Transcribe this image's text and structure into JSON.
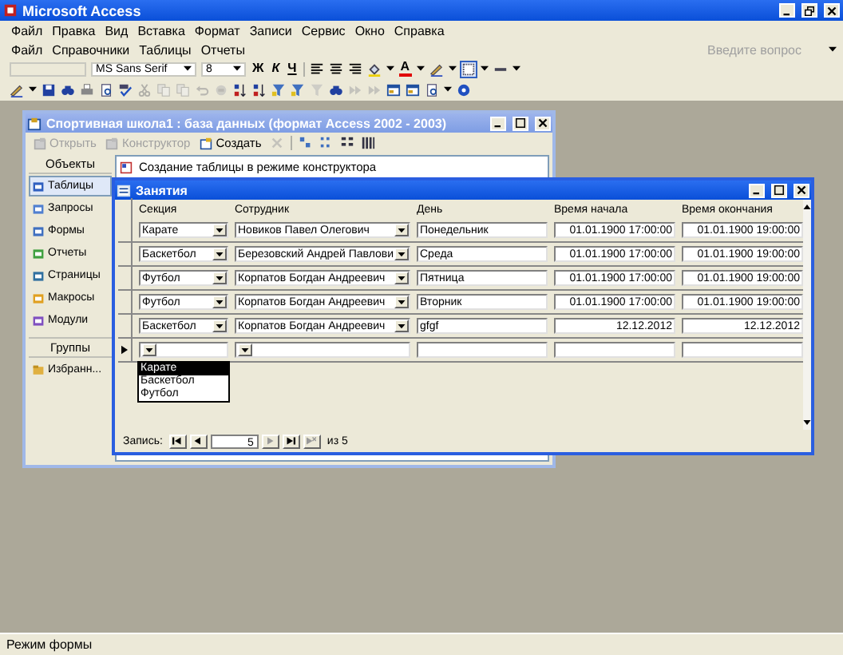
{
  "window": {
    "title": "Microsoft Access"
  },
  "menu": [
    "Файл",
    "Правка",
    "Вид",
    "Вставка",
    "Формат",
    "Записи",
    "Сервис",
    "Окно",
    "Справка"
  ],
  "custom_menu": [
    "Файл",
    "Справочники",
    "Таблицы",
    "Отчеты"
  ],
  "help_box": {
    "placeholder": "Введите вопрос"
  },
  "format_toolbar": {
    "font": "MS Sans Serif",
    "size": "8",
    "style_buttons": [
      "Ж",
      "К",
      "Ч"
    ],
    "font_color_label": "A"
  },
  "db_window": {
    "title": "Спортивная школа1 : база данных (формат Access 2002 - 2003)",
    "toolbar": [
      {
        "label": "Открыть",
        "disabled": true
      },
      {
        "label": "Конструктор",
        "disabled": true
      },
      {
        "label": "Создать",
        "disabled": false
      }
    ],
    "objects_header": "Объекты",
    "objects": [
      {
        "label": "Таблицы",
        "selected": true
      },
      {
        "label": "Запросы",
        "selected": false
      },
      {
        "label": "Формы",
        "selected": false
      },
      {
        "label": "Отчеты",
        "selected": false
      },
      {
        "label": "Страницы",
        "selected": false
      },
      {
        "label": "Макросы",
        "selected": false
      },
      {
        "label": "Модули",
        "selected": false
      }
    ],
    "groups_header": "Группы",
    "groups": [
      "Избранн..."
    ],
    "list": [
      "Создание таблицы в режиме конструктора"
    ]
  },
  "form": {
    "title": "Занятия",
    "columns": [
      "Секция",
      "Сотрудник",
      "День",
      "Время начала",
      "Время окончания"
    ],
    "rows": [
      {
        "section": "Карате",
        "employee": "Новиков Павел Олегович",
        "day": "Понедельник",
        "start": "01.01.1900 17:00:00",
        "end": "01.01.1900 19:00:00",
        "current": false
      },
      {
        "section": "Баскетбол",
        "employee": "Березовский Андрей Павлови",
        "day": "Среда",
        "start": "01.01.1900 17:00:00",
        "end": "01.01.1900 19:00:00",
        "current": false
      },
      {
        "section": "Футбол",
        "employee": "Корпатов Богдан Андреевич",
        "day": "Пятница",
        "start": "01.01.1900 17:00:00",
        "end": "01.01.1900 19:00:00",
        "current": false
      },
      {
        "section": "Футбол",
        "employee": "Корпатов Богдан Андреевич",
        "day": "Вторник",
        "start": "01.01.1900 17:00:00",
        "end": "01.01.1900 19:00:00",
        "current": false
      },
      {
        "section": "Баскетбол",
        "employee": "Корпатов Богдан Андреевич",
        "day": "gfgf",
        "start": "12.12.2012",
        "end": "12.12.2012",
        "current": false
      }
    ],
    "new_row": {
      "current": true
    },
    "dropdown": [
      {
        "label": "Карате",
        "selected": true
      },
      {
        "label": "Баскетбол",
        "selected": false
      },
      {
        "label": "Футбол",
        "selected": false
      }
    ],
    "nav": {
      "label": "Запись:",
      "current": "5",
      "total": "из 5"
    }
  },
  "status_bar": "Режим формы"
}
